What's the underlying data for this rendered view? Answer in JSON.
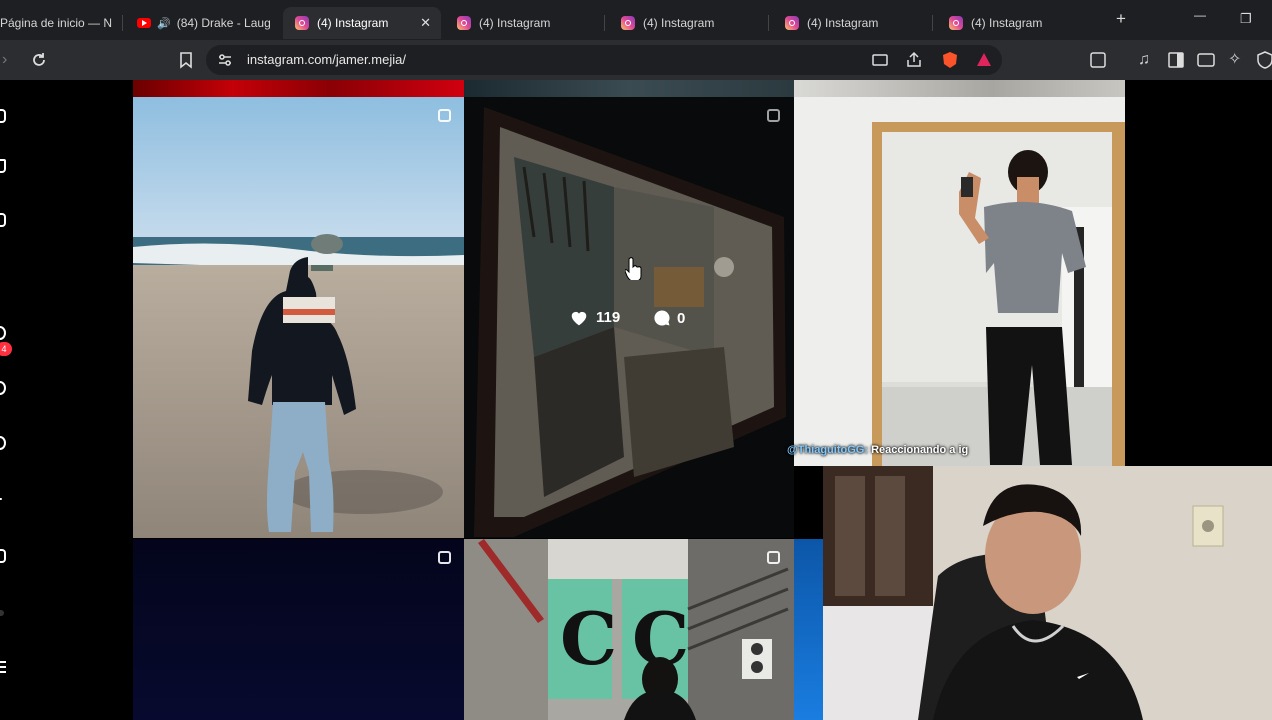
{
  "browser": {
    "tabs": [
      {
        "title": "Página de inicio — N",
        "type": "netflix",
        "active": false
      },
      {
        "title": "(84) Drake - Laug",
        "type": "youtube",
        "active": false,
        "audio": true
      },
      {
        "title": "(4) Instagram",
        "type": "instagram",
        "active": true
      },
      {
        "title": "(4) Instagram",
        "type": "instagram",
        "active": false
      },
      {
        "title": "(4) Instagram",
        "type": "instagram",
        "active": false
      },
      {
        "title": "(4) Instagram",
        "type": "instagram",
        "active": false
      },
      {
        "title": "(4) Instagram",
        "type": "instagram",
        "active": false
      }
    ],
    "close_tab_glyph": "✕",
    "new_tab_glyph": "+",
    "url": "instagram.com/jamer.mejia/",
    "window_controls": {
      "minimize": "—",
      "restore": "❐"
    }
  },
  "sidebar": {
    "notification_count": "4",
    "icons": [
      "instagram-logo-icon",
      "home-icon",
      "reels-icon",
      "messages-icon",
      "search-icon",
      "explore-icon",
      "notifications-icon",
      "create-icon",
      "profile-icon",
      "more-icon"
    ]
  },
  "grid": {
    "hovered_post": {
      "likes": "119",
      "comments": "0"
    },
    "posts": [
      {
        "description": "beach-photo",
        "multi": true
      },
      {
        "description": "painting-photo",
        "multi": true
      },
      {
        "description": "mirror-selfie-photo",
        "multi": false
      },
      {
        "description": "night-sky-photo",
        "multi": true
      },
      {
        "description": "cc-building-photo",
        "multi": true
      },
      {
        "description": "blue-photo",
        "multi": false
      }
    ]
  },
  "stream": {
    "chat_user": "@ThiaguitoGG:",
    "chat_message": "Reaccionando a ig"
  },
  "colors": {
    "accent_badge": "#ff3040",
    "tab_bar": "#1e1f22",
    "toolbar": "#2c2d31",
    "brave_orange": "#fb542b"
  }
}
